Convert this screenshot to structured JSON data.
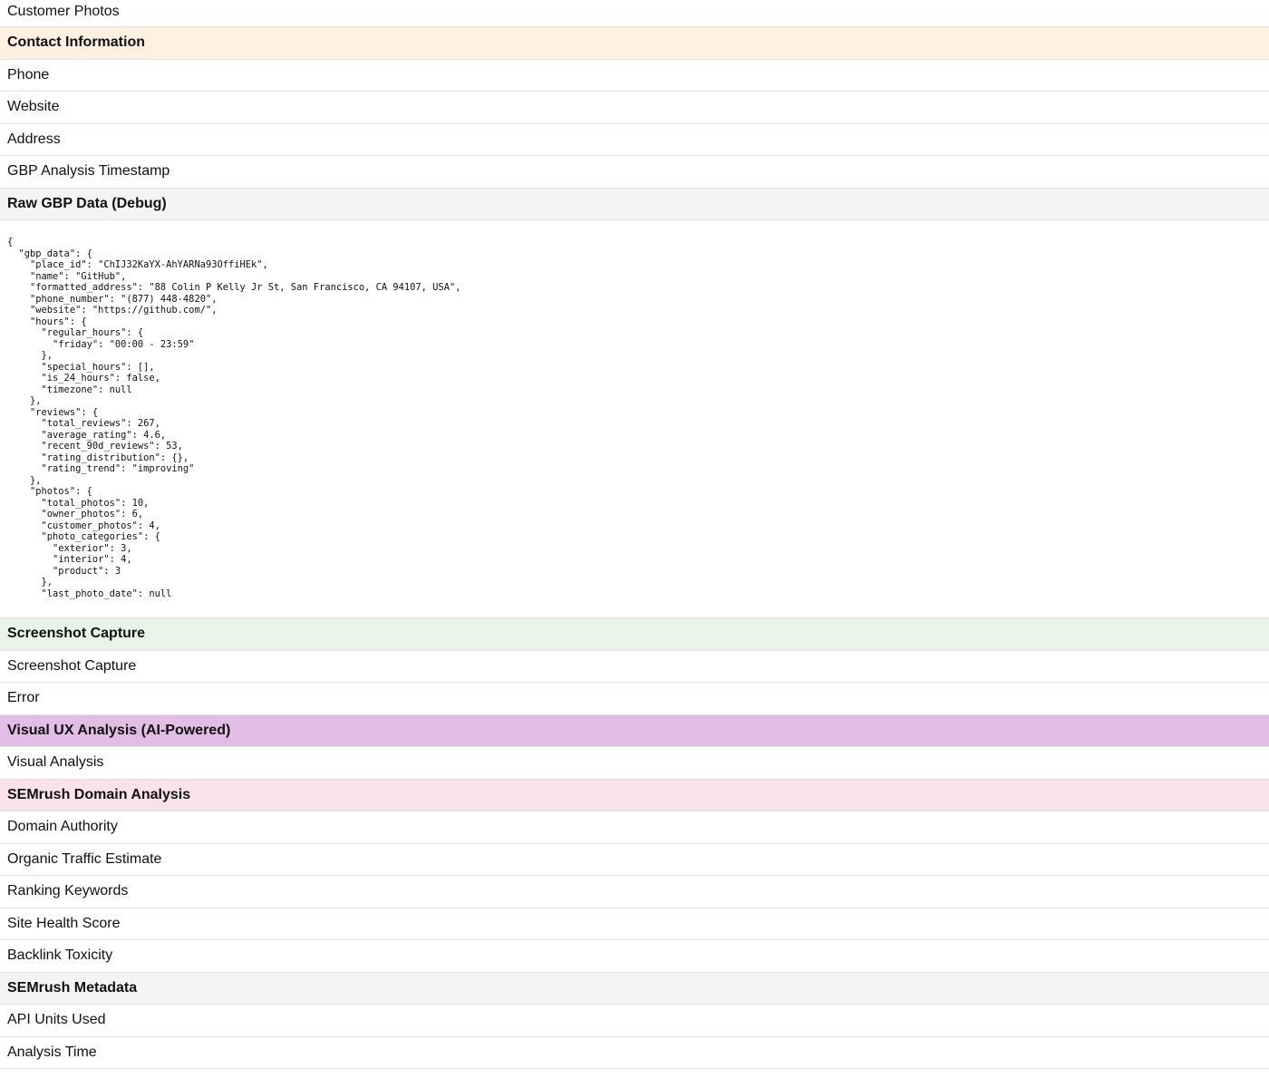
{
  "rows": {
    "customer_photos": "Customer Photos",
    "contact_section": "Contact Information",
    "phone": "Phone",
    "website": "Website",
    "address": "Address",
    "gbp_timestamp": "GBP Analysis Timestamp",
    "raw_section": "Raw GBP Data (Debug)",
    "screenshot_section": "Screenshot Capture",
    "screenshot_capture": "Screenshot Capture",
    "error": "Error",
    "visual_section": "Visual UX Analysis (AI-Powered)",
    "visual_analysis": "Visual Analysis",
    "semrush_section": "SEMrush Domain Analysis",
    "domain_authority": "Domain Authority",
    "organic_traffic": "Organic Traffic Estimate",
    "ranking_keywords": "Ranking Keywords",
    "site_health": "Site Health Score",
    "backlink_toxicity": "Backlink Toxicity",
    "semrush_meta_section": "SEMrush Metadata",
    "api_units": "API Units Used",
    "analysis_time": "Analysis Time"
  },
  "raw_gbp_json": "{\n  \"gbp_data\": {\n    \"place_id\": \"ChIJ32KaYX-AhYARNa93OffiHEk\",\n    \"name\": \"GitHub\",\n    \"formatted_address\": \"88 Colin P Kelly Jr St, San Francisco, CA 94107, USA\",\n    \"phone_number\": \"(877) 448-4820\",\n    \"website\": \"https://github.com/\",\n    \"hours\": {\n      \"regular_hours\": {\n        \"friday\": \"00:00 - 23:59\"\n      },\n      \"special_hours\": [],\n      \"is_24_hours\": false,\n      \"timezone\": null\n    },\n    \"reviews\": {\n      \"total_reviews\": 267,\n      \"average_rating\": 4.6,\n      \"recent_90d_reviews\": 53,\n      \"rating_distribution\": {},\n      \"rating_trend\": \"improving\"\n    },\n    \"photos\": {\n      \"total_photos\": 10,\n      \"owner_photos\": 6,\n      \"customer_photos\": 4,\n      \"photo_categories\": {\n        \"exterior\": 3,\n        \"interior\": 4,\n        \"product\": 3\n      },\n      \"last_photo_date\": null",
  "colors": {
    "section_orange": "#fff1e1",
    "section_gray": "#f4f4f4",
    "section_green": "#e7f4e7",
    "section_purple": "#e2bde5",
    "section_pink": "#fae2ea",
    "row_border": "#e3e3e3"
  }
}
